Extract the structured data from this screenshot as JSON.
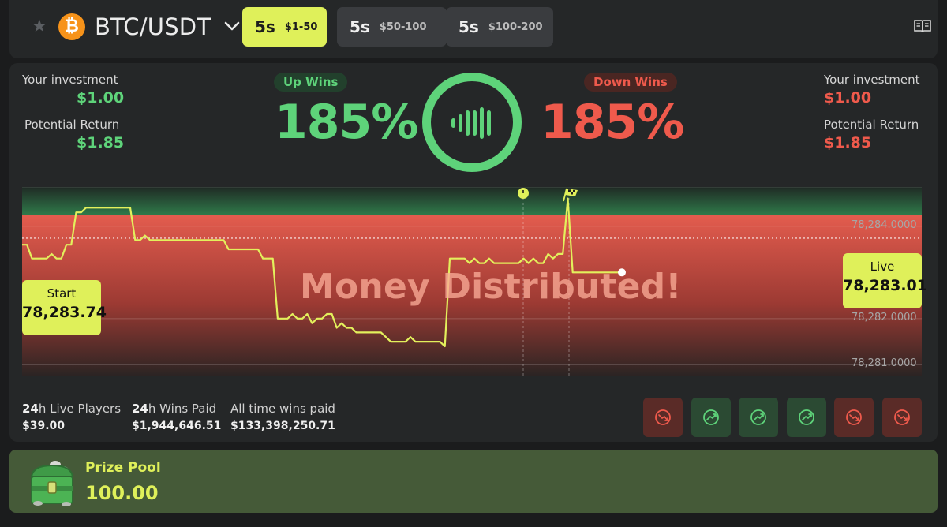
{
  "header": {
    "base": "BTC",
    "separator": "/",
    "quote": "USDT",
    "coin_icon": "bitcoin-icon",
    "tabs": [
      {
        "time": "5s",
        "range": "$1-50",
        "active": true
      },
      {
        "time": "5s",
        "range": "$50-100",
        "active": false
      },
      {
        "time": "5s",
        "range": "$100-200",
        "active": false
      }
    ]
  },
  "up": {
    "investment_label": "Your investment",
    "investment": "$1.00",
    "return_label": "Potential Return",
    "return": "$1.85",
    "pill": "Up Wins",
    "pct": "185%"
  },
  "down": {
    "investment_label": "Your investment",
    "investment": "$1.00",
    "return_label": "Potential Return",
    "return": "$1.85",
    "pill": "Down Wins",
    "pct": "185%"
  },
  "chart": {
    "overlay": "Money Distributed!",
    "start_label": "Start",
    "start_value": "78,283.74",
    "live_label": "Live",
    "live_value": "78,283.01",
    "y_ticks": [
      "78,284.0000",
      "78,282.0000",
      "78,281.0000"
    ]
  },
  "chart_data": {
    "type": "line",
    "series": [
      {
        "values": [
          78283.6,
          78283.6,
          78283.3,
          78283.3,
          78283.3,
          78283.3,
          78283.4,
          78283.3,
          78283.3,
          78283.6,
          78283.6,
          78284.3,
          78284.3,
          78284.4,
          78284.4,
          78284.4,
          78284.4,
          78284.4,
          78284.4,
          78284.4,
          78284.4,
          78284.4,
          78284.4,
          78283.7,
          78283.7,
          78283.8,
          78283.7,
          78283.7,
          78283.7,
          78283.7,
          78283.7,
          78283.7,
          78283.7,
          78283.7,
          78283.7,
          78283.7,
          78283.7,
          78283.7,
          78283.7,
          78283.7,
          78283.7,
          78283.7,
          78283.5,
          78283.5,
          78283.5,
          78283.5,
          78283.5,
          78283.5,
          78283.5,
          78283.3,
          78283.3,
          78283.3,
          78282.0,
          78282.0,
          78282.0,
          78282.1,
          78282.0,
          78282.0,
          78282.1,
          78281.9,
          78282.0,
          78282.0,
          78282.1,
          78282.1,
          78281.8,
          78281.9,
          78281.8,
          78281.8,
          78281.7,
          78281.7,
          78281.7,
          78281.7,
          78281.7,
          78281.7,
          78281.6,
          78281.5,
          78281.5,
          78281.5,
          78281.5,
          78281.6,
          78281.5,
          78281.5,
          78281.5,
          78281.5,
          78281.5,
          78281.5,
          78281.4,
          78283.3,
          78283.3,
          78283.3,
          78283.3,
          78283.2,
          78283.3,
          78283.2,
          78283.2,
          78283.3,
          78283.2,
          78283.2,
          78283.2,
          78283.2,
          78283.2,
          78283.2,
          78283.3,
          78283.2,
          78283.3,
          78283.2,
          78283.2,
          78283.4,
          78283.3,
          78283.4,
          78283.4,
          78284.6,
          78283.0,
          78283.0,
          78283.0,
          78283.0,
          78283.0,
          78283.0,
          78283.0,
          78283.0,
          78283.0,
          78283.0,
          78283.0
        ]
      }
    ],
    "start": 78283.74,
    "live": 78283.01,
    "y_ticks": [
      78284,
      78282,
      78281
    ],
    "ylim": [
      78280.75,
      78284.85
    ],
    "grid": true
  },
  "stats": [
    {
      "prefix": "24",
      "label": "h Live Players",
      "value": "$39.00"
    },
    {
      "prefix": "24",
      "label": "h Wins Paid",
      "value": "$1,944,646.51"
    },
    {
      "prefix": "",
      "label": "All time wins paid",
      "value": "$133,398,250.71"
    }
  ],
  "history": [
    "down",
    "up",
    "up",
    "up",
    "down",
    "down"
  ],
  "prize": {
    "label": "Prize Pool",
    "value": "100.00"
  },
  "colors": {
    "accent": "#dff05a",
    "up": "#5ed37a",
    "down": "#ef5a4c",
    "panel": "#252728",
    "background": "#1b1c1d"
  }
}
